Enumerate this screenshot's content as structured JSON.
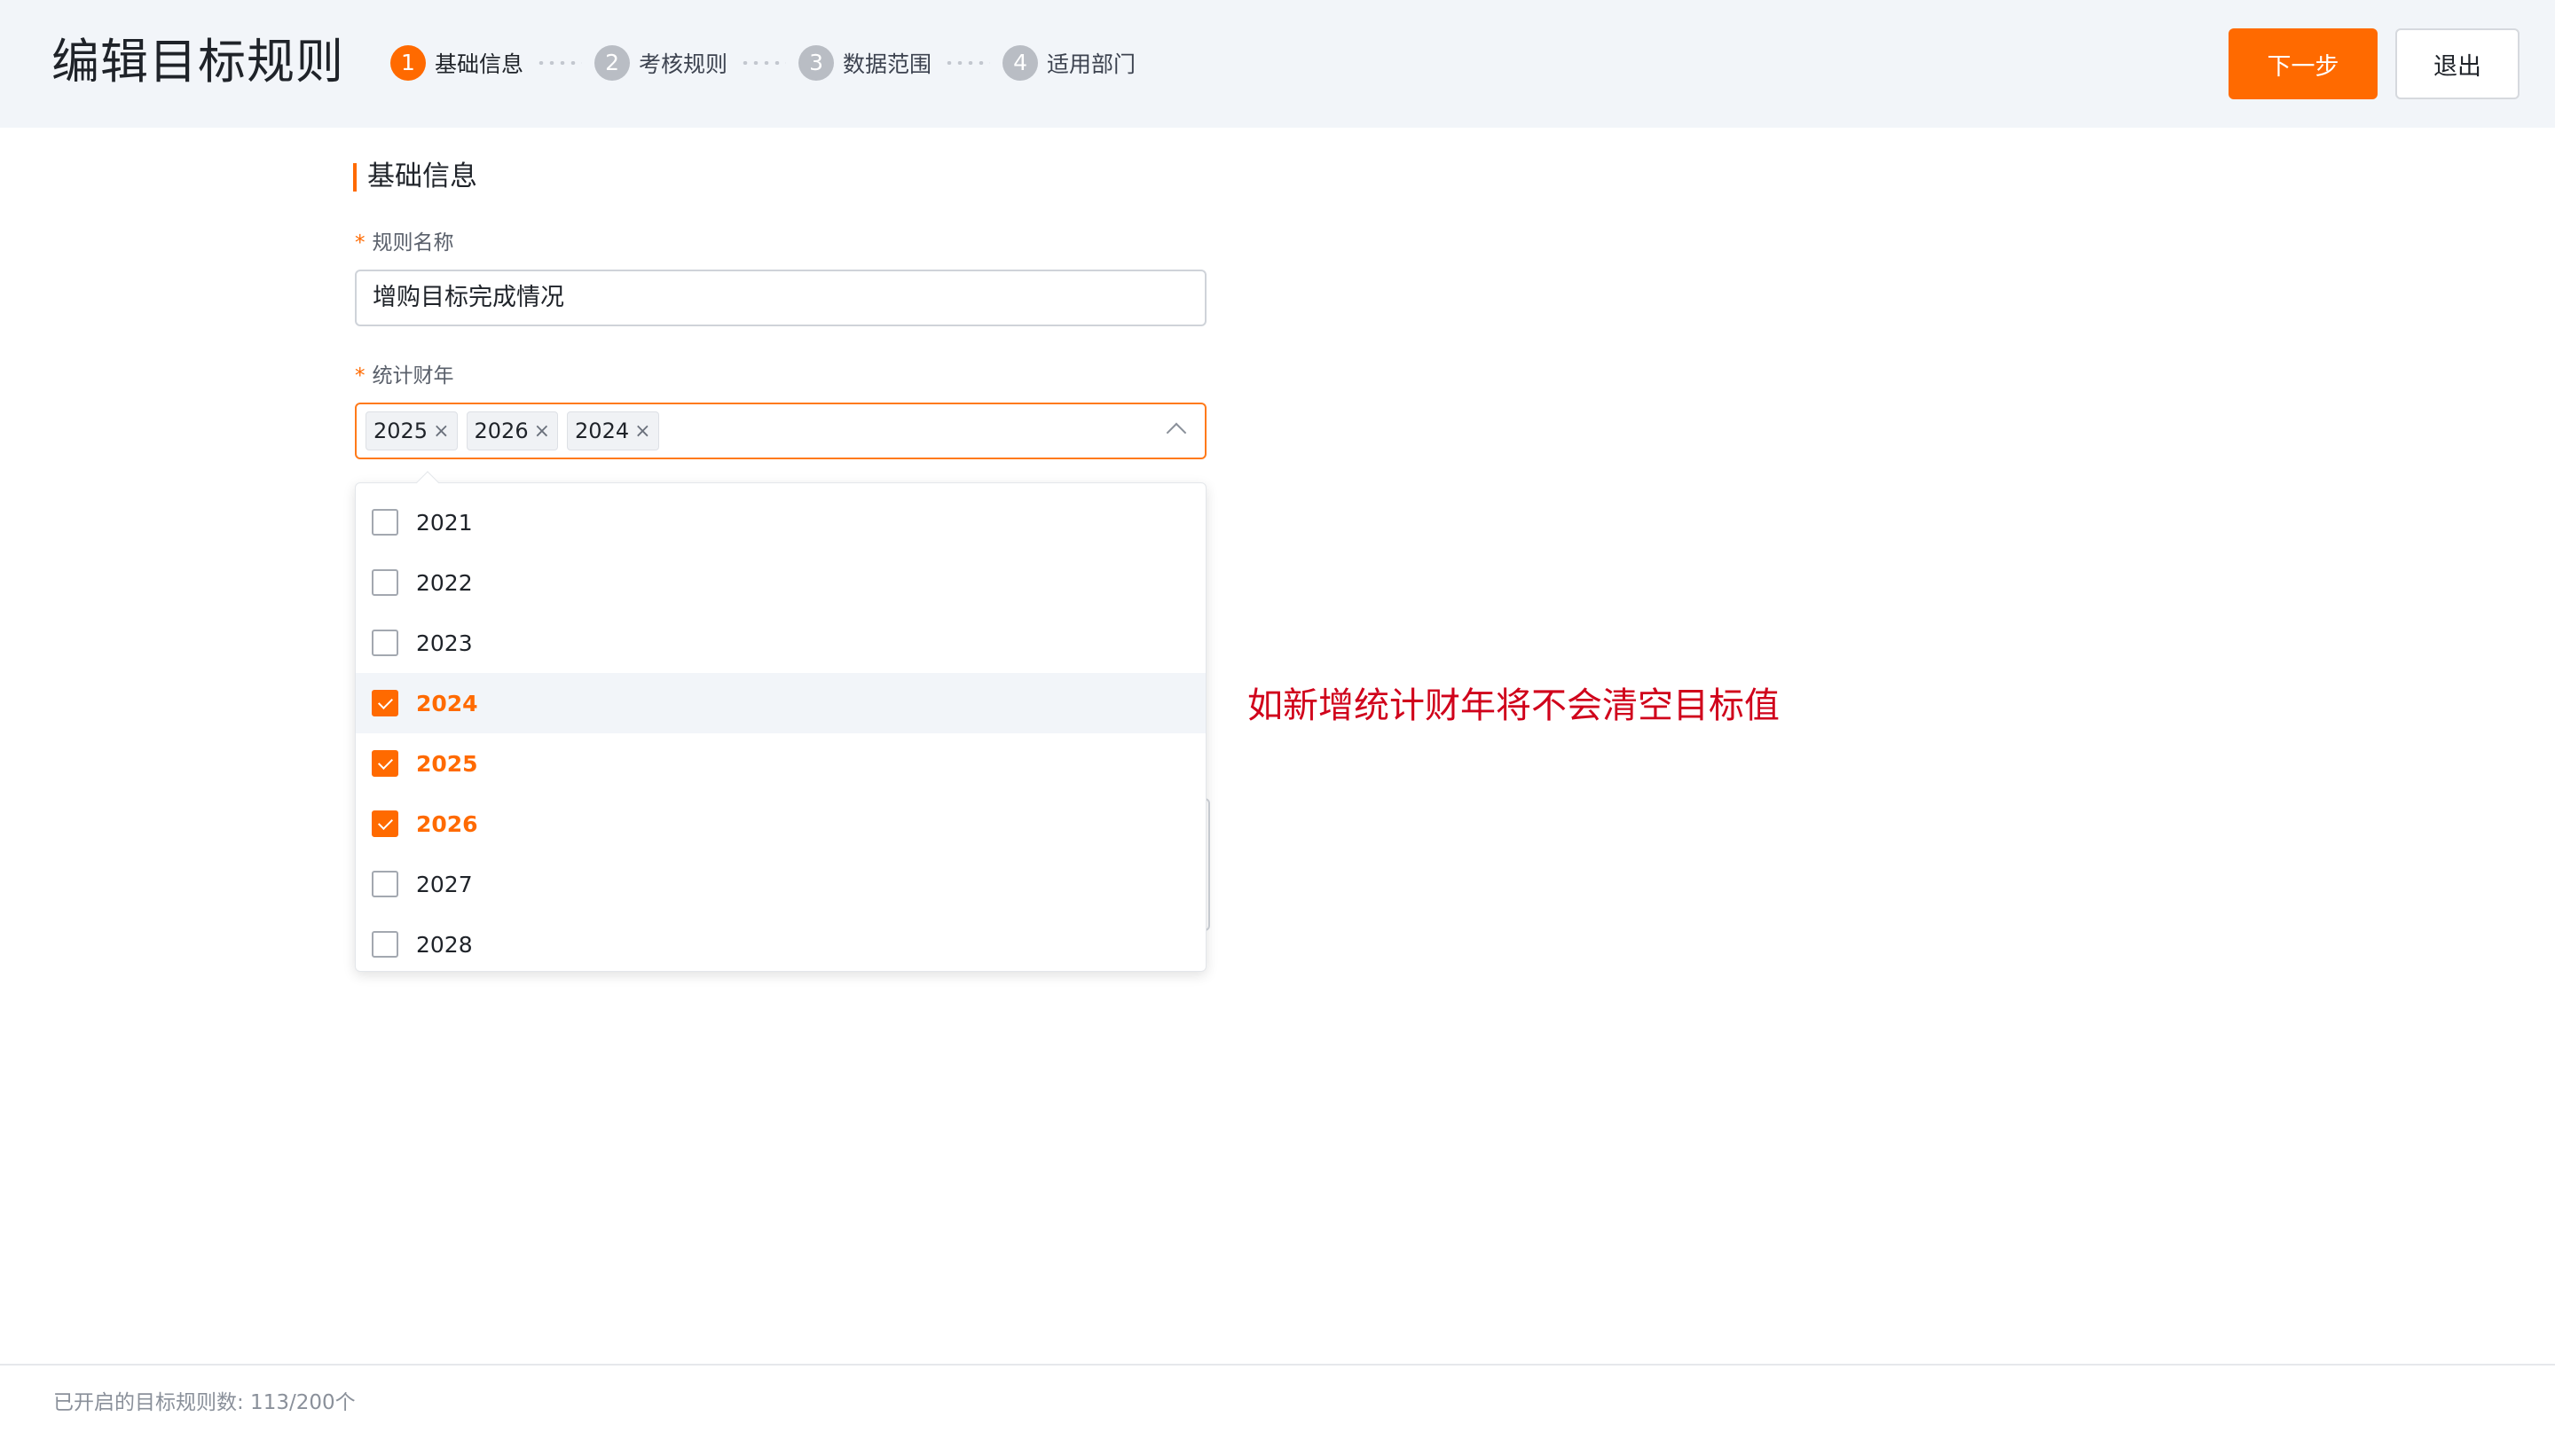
{
  "header": {
    "title": "编辑目标规则",
    "next_label": "下一步",
    "exit_label": "退出",
    "accent_color": "#ff6a00"
  },
  "steps": [
    {
      "num": "1",
      "label": "基础信息",
      "active": true
    },
    {
      "num": "2",
      "label": "考核规则",
      "active": false
    },
    {
      "num": "3",
      "label": "数据范围",
      "active": false
    },
    {
      "num": "4",
      "label": "适用部门",
      "active": false
    }
  ],
  "section": {
    "title": "基础信息"
  },
  "form": {
    "required_mark": "*",
    "name_label": "规则名称",
    "name_value": "增购目标完成情况",
    "year_label": "统计财年",
    "selected_tags": [
      "2025",
      "2026",
      "2024"
    ],
    "tag_close": "×"
  },
  "dropdown": {
    "options": [
      {
        "label": "2021",
        "checked": false
      },
      {
        "label": "2022",
        "checked": false
      },
      {
        "label": "2023",
        "checked": false
      },
      {
        "label": "2024",
        "checked": true
      },
      {
        "label": "2025",
        "checked": true
      },
      {
        "label": "2026",
        "checked": true
      },
      {
        "label": "2027",
        "checked": false
      },
      {
        "label": "2028",
        "checked": false
      }
    ],
    "highlighted": "2024"
  },
  "annotation": {
    "text": "如新增统计财年将不会清空目标值",
    "color": "#d0021b"
  },
  "footer": {
    "text": "已开启的目标规则数: 113/200个"
  }
}
